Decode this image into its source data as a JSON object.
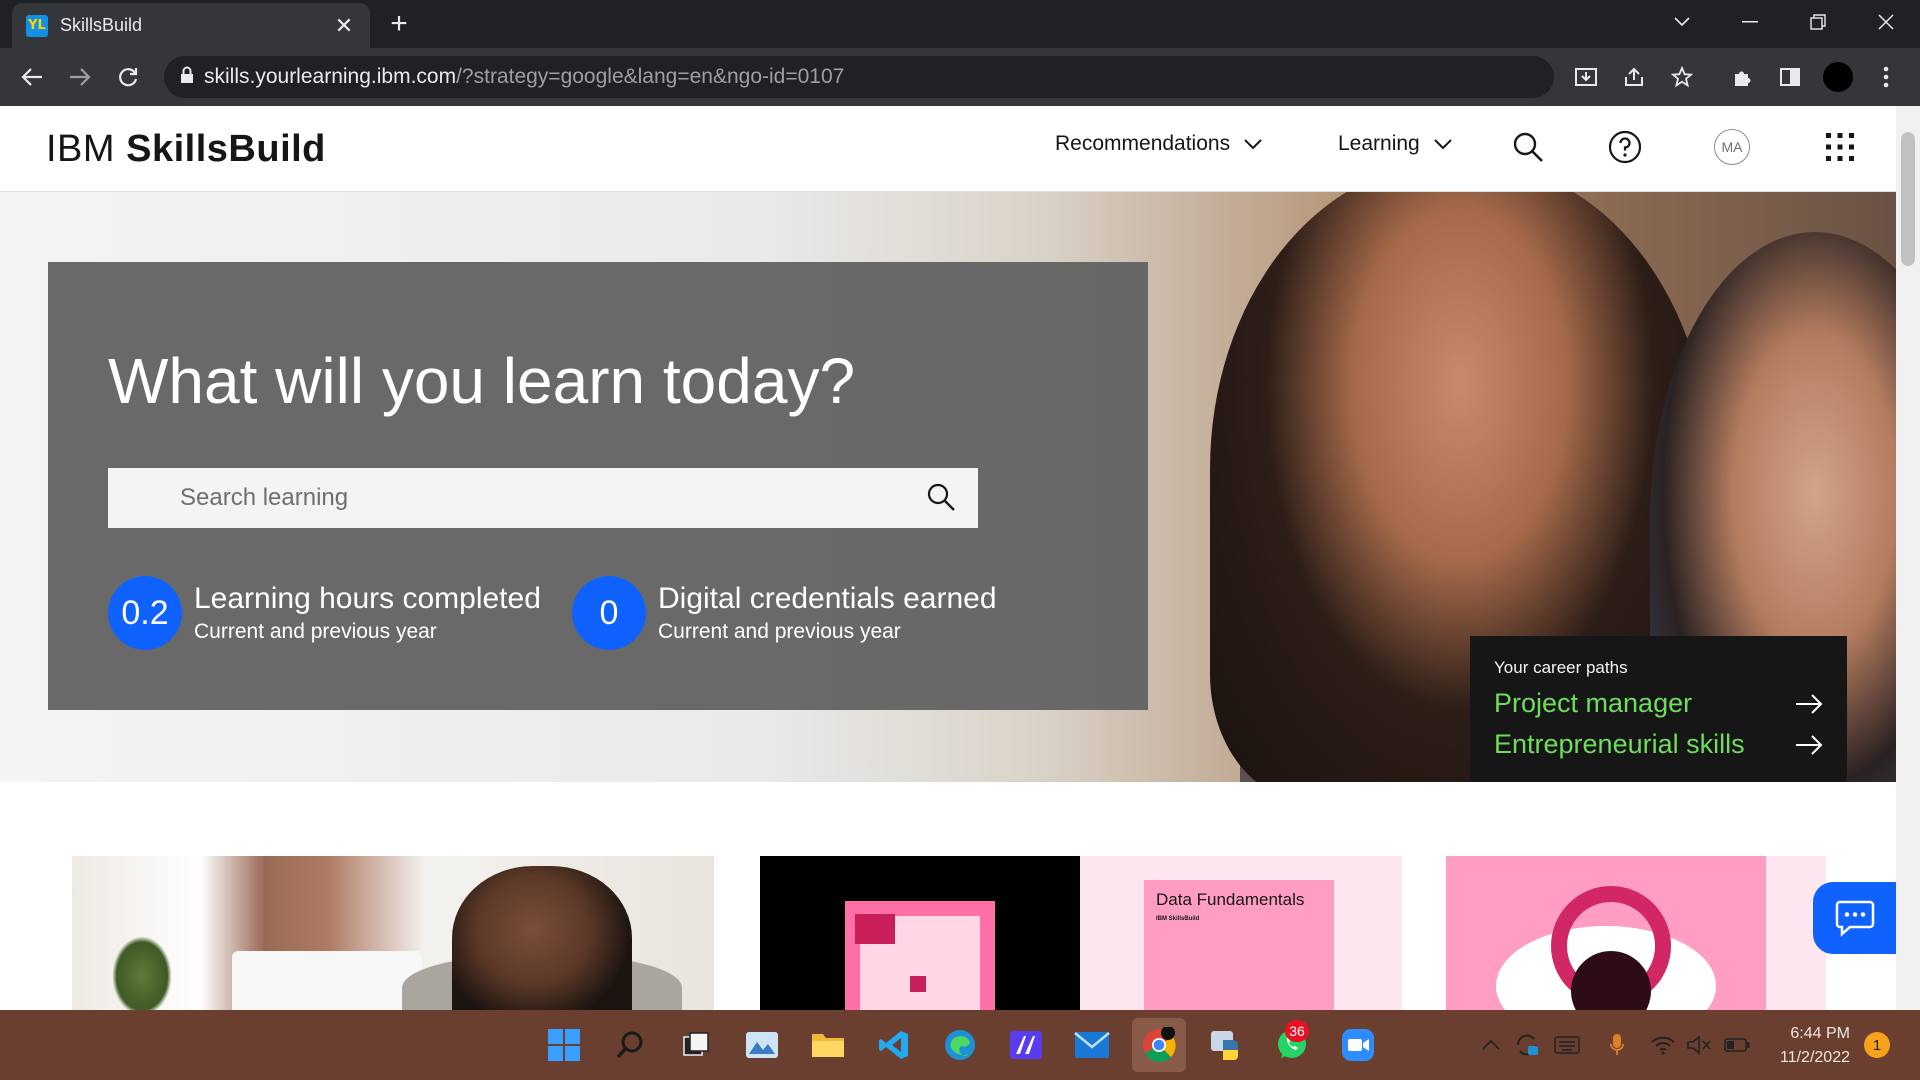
{
  "browser": {
    "tab_title": "SkillsBuild",
    "tab_favicon_text": "YL",
    "url_host": "skills.yourlearning.ibm.com",
    "url_rest": "/?strategy=google&lang=en&ngo-id=0107"
  },
  "header": {
    "brand_light": "IBM",
    "brand_bold": "SkillsBuild",
    "nav": [
      "Recommendations",
      "Learning"
    ],
    "avatar_initials": "MA"
  },
  "hero": {
    "title": "What will you learn today?",
    "search_placeholder": "Search learning",
    "stats": [
      {
        "value": "0.2",
        "title": "Learning hours completed",
        "subtitle": "Current and previous year"
      },
      {
        "value": "0",
        "title": "Digital credentials earned",
        "subtitle": "Current and previous year"
      }
    ],
    "career": {
      "heading": "Your career paths",
      "links": [
        "Project manager",
        "Entrepreneurial skills"
      ]
    }
  },
  "cards": {
    "card2_title": "Data Fundamentals",
    "card2_sub": "IBM SkillsBuild"
  },
  "taskbar": {
    "whatsapp_badge": "36",
    "time": "6:44 PM",
    "date": "11/2/2022",
    "notifications": "1"
  },
  "colors": {
    "ibm_blue": "#0f62fe",
    "career_green": "#6fdc5c",
    "hero_card": "#646464"
  }
}
